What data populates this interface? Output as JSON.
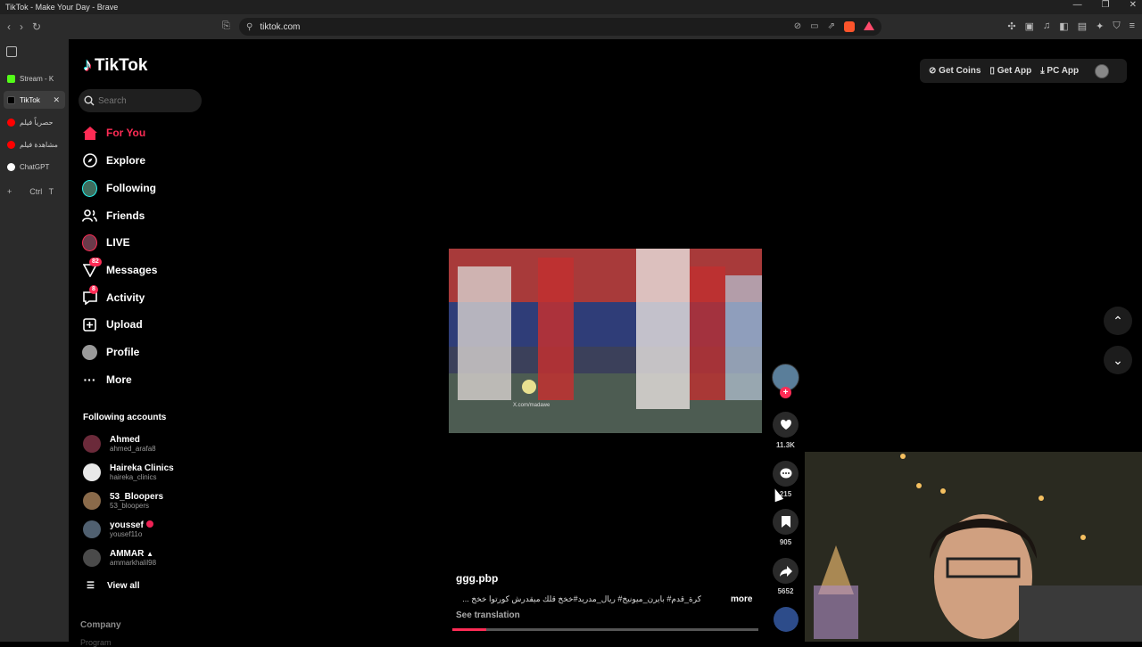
{
  "window": {
    "title": "TikTok - Make Your Day - Brave"
  },
  "browser": {
    "url": "tiktok.com",
    "tabs": [
      {
        "label": "Stream - K",
        "favicon_color": "#53fc18"
      },
      {
        "label": "TikTok",
        "favicon_color": "#000000",
        "active": true
      },
      {
        "label": "حصرياً فيلم",
        "favicon_color": "#ff0000"
      },
      {
        "label": "مشاهدة فيلم",
        "favicon_color": "#ff0000"
      },
      {
        "label": "ChatGPT",
        "favicon_color": "#ffffff"
      }
    ],
    "new_tab_shortcut": {
      "ctrl": "Ctrl",
      "key": "T"
    }
  },
  "tiktok": {
    "logo_text": "TikTok",
    "search_placeholder": "Search",
    "nav": [
      {
        "label": "For You",
        "icon": "home-icon",
        "active": true
      },
      {
        "label": "Explore",
        "icon": "compass-icon"
      },
      {
        "label": "Following",
        "icon": "following-avatar-icon"
      },
      {
        "label": "Friends",
        "icon": "friends-icon"
      },
      {
        "label": "LIVE",
        "icon": "live-icon"
      },
      {
        "label": "Messages",
        "icon": "messages-icon",
        "badge": "82"
      },
      {
        "label": "Activity",
        "icon": "activity-icon",
        "badge": "8"
      },
      {
        "label": "Upload",
        "icon": "upload-icon"
      },
      {
        "label": "Profile",
        "icon": "profile-avatar-icon"
      },
      {
        "label": "More",
        "icon": "more-dots-icon"
      }
    ],
    "following_title": "Following accounts",
    "accounts": [
      {
        "name": "Ahmed",
        "username": "ahmed_arafa8",
        "avatar_color": "#6b2a3a"
      },
      {
        "name": "Haireka Clinics",
        "username": "haireka_clinics",
        "avatar_color": "#e8e8e8"
      },
      {
        "name": "53_Bloopers",
        "username": "53_bloopers",
        "avatar_color": "#8a6a4a"
      },
      {
        "name": "youssef",
        "username": "yousef11o",
        "avatar_color": "#506070"
      },
      {
        "name": "AMMAR",
        "username": "ammarkhalil98",
        "avatar_color": "#4a4a4a"
      }
    ],
    "view_all": "View all",
    "company": "Company",
    "program": "Program",
    "top_actions": {
      "coins": "Get Coins",
      "app": "Get App",
      "pc": "PC App"
    },
    "video": {
      "watermark": "X.com/madawe",
      "author": "ggg.pbp",
      "caption": "كرة_قدم# بايرن_ميونيخ# ريال_مدريد#خخخ قلك ميقدرش كورتوا خخخ ...",
      "more": "more",
      "see_translation": "See translation",
      "progress": 0.11,
      "likes": "11.3K",
      "comments": "215",
      "saves": "905",
      "shares": "5652"
    }
  },
  "colors": {
    "accent": "#fe2c55",
    "sidebar_bg": "#2b2b2b"
  }
}
